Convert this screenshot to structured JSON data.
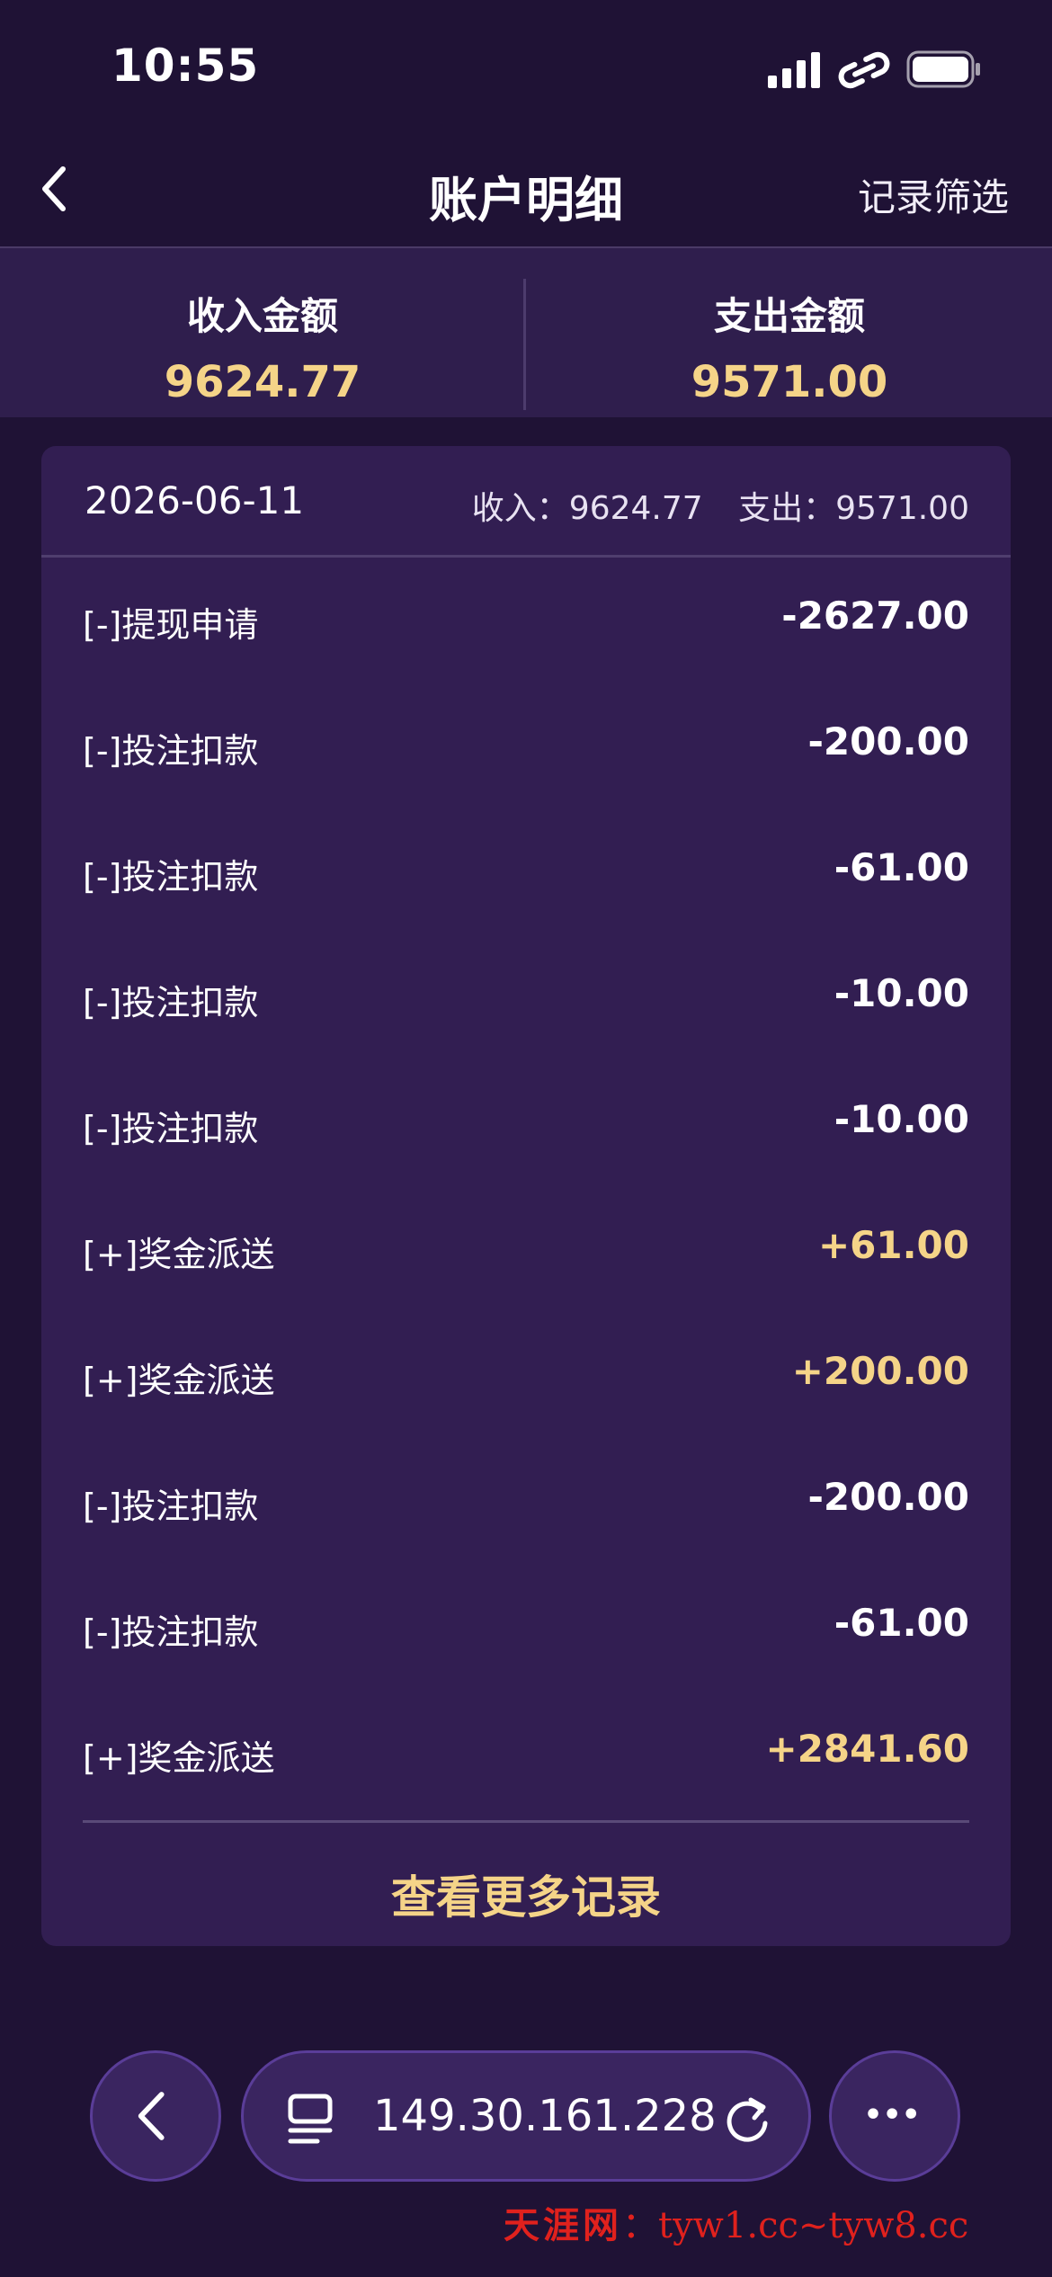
{
  "status_bar": {
    "time": "10:55"
  },
  "nav": {
    "title": "账户明细",
    "filter_label": "记录筛选"
  },
  "summary": {
    "income_label": "收入金额",
    "income_value": "9624.77",
    "expense_label": "支出金额",
    "expense_value": "9571.00"
  },
  "card": {
    "date": "2026-06-11",
    "income_total": "收入：9624.77",
    "expense_total": "支出：9571.00",
    "rows": [
      {
        "label": "[-]提现申请",
        "amount": "-2627.00"
      },
      {
        "label": "[-]投注扣款",
        "amount": "-200.00"
      },
      {
        "label": "[-]投注扣款",
        "amount": "-61.00"
      },
      {
        "label": "[-]投注扣款",
        "amount": "-10.00"
      },
      {
        "label": "[-]投注扣款",
        "amount": "-10.00"
      },
      {
        "label": "[+]奖金派送",
        "amount": "+61.00"
      },
      {
        "label": "[+]奖金派送",
        "amount": "+200.00"
      },
      {
        "label": "[-]投注扣款",
        "amount": "-200.00"
      },
      {
        "label": "[-]投注扣款",
        "amount": "-61.00"
      },
      {
        "label": "[+]奖金派送",
        "amount": "+2841.60"
      }
    ],
    "more_label": "查看更多记录"
  },
  "browser": {
    "url": "149.30.161.228"
  },
  "watermark": {
    "site_name": "天涯网",
    "separator": "：",
    "urls": "tyw1.cc~tyw8.cc"
  },
  "colors": {
    "background": "#1f1235",
    "card": "#321e52",
    "accent": "#f5d488",
    "watermark": "#e0211d"
  }
}
